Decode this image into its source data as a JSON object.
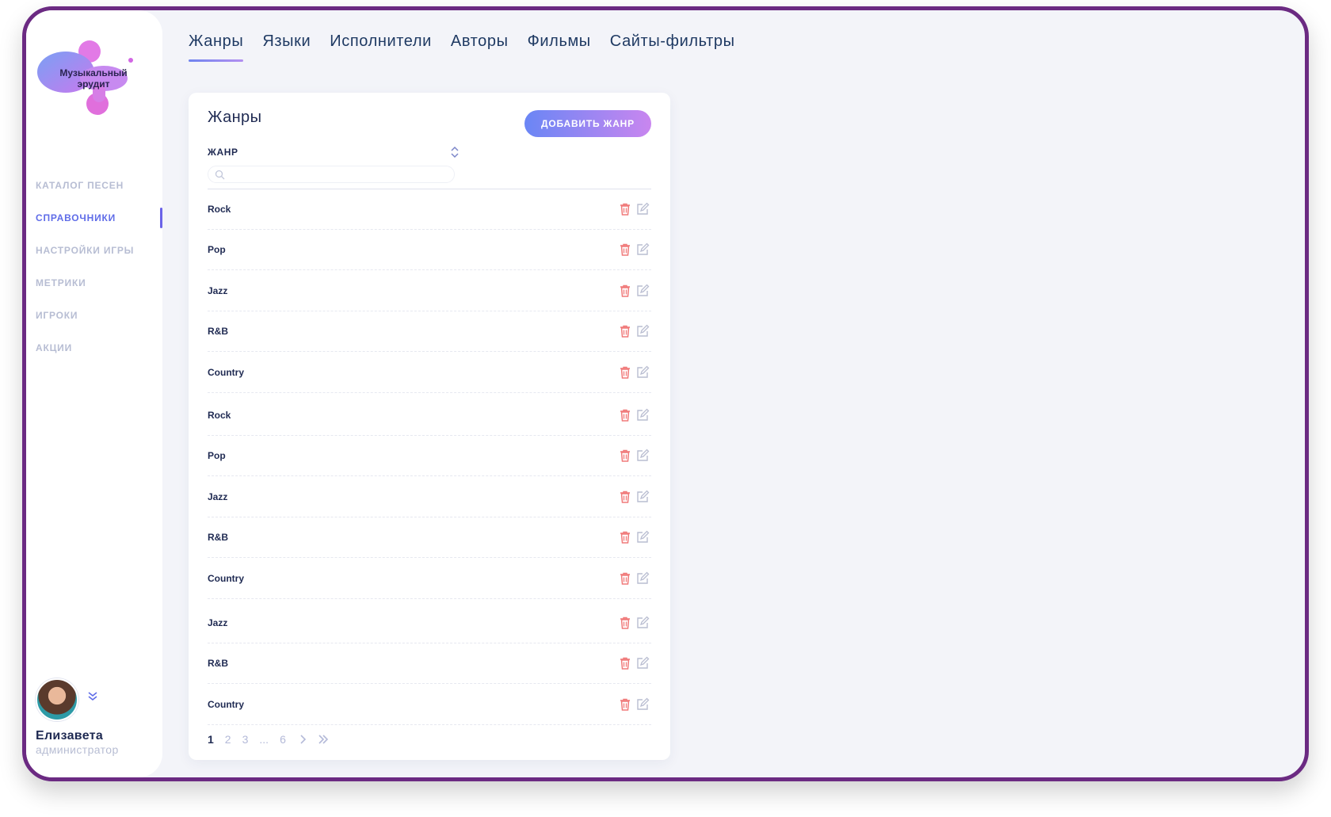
{
  "sidebar": {
    "logo_text": "Музыкальный эрудит",
    "nav": [
      {
        "label": "КАТАЛОГ ПЕСЕН",
        "active": false
      },
      {
        "label": "СПРАВОЧНИКИ",
        "active": true
      },
      {
        "label": "НАСТРОЙКИ ИГРЫ",
        "active": false
      },
      {
        "label": "МЕТРИКИ",
        "active": false
      },
      {
        "label": "ИГРОКИ",
        "active": false
      },
      {
        "label": "АКЦИИ",
        "active": false
      }
    ],
    "user": {
      "name": "Елизавета",
      "role": "администратор"
    }
  },
  "tabs": [
    {
      "label": "Жанры",
      "active": true
    },
    {
      "label": "Языки",
      "active": false
    },
    {
      "label": "Исполнители",
      "active": false
    },
    {
      "label": "Авторы",
      "active": false
    },
    {
      "label": "Фильмы",
      "active": false
    },
    {
      "label": "Сайты-фильтры",
      "active": false
    }
  ],
  "card": {
    "title": "Жанры",
    "add_button": "ДОБАВИТЬ ЖАНР",
    "column_label": "ЖАНР",
    "search": {
      "value": "",
      "placeholder": ""
    },
    "rows": [
      "Rock",
      "Pop",
      "Jazz",
      "R&B",
      "Country",
      "Rock",
      "Pop",
      "Jazz",
      "R&B",
      "Country",
      "Jazz",
      "R&B",
      "Country"
    ]
  },
  "pagination": {
    "pages": [
      "1",
      "2",
      "3"
    ],
    "ellipsis": "...",
    "last": "6",
    "current": "1"
  },
  "colors": {
    "frame_border": "#6b2a82",
    "accent": "#5f6ce8",
    "delete_icon": "#f07a7a",
    "edit_icon": "#b9bdd1",
    "text_dark": "#1f2a52",
    "muted": "#b7bdd3"
  }
}
